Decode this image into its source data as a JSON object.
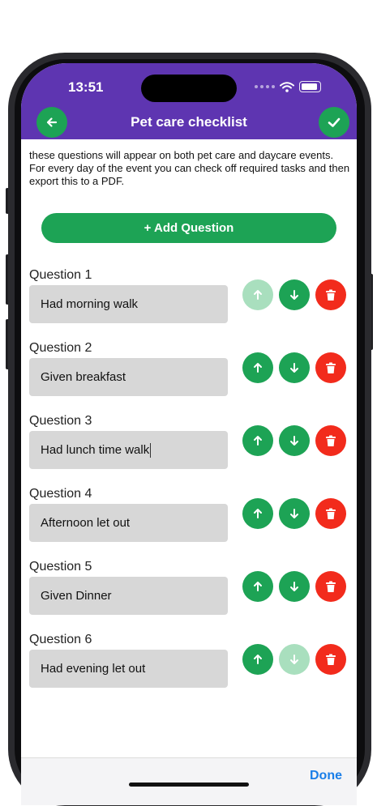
{
  "status_bar": {
    "time": "13:51"
  },
  "header": {
    "title": "Pet care checklist",
    "back_icon": "arrow-left-icon",
    "confirm_icon": "checkmark-icon",
    "color": "#5e35b1"
  },
  "intro_text": "these questions will appear on both pet care and daycare events. For every day of the event you can check off required tasks and then export this to a PDF.",
  "add_button": {
    "label": "+ Add Question"
  },
  "questions": [
    {
      "label": "Question 1",
      "value": "Had morning walk",
      "up_enabled": false,
      "down_enabled": true
    },
    {
      "label": "Question 2",
      "value": "Given breakfast",
      "up_enabled": true,
      "down_enabled": true
    },
    {
      "label": "Question 3",
      "value": "Had lunch time walk",
      "up_enabled": true,
      "down_enabled": true
    },
    {
      "label": "Question 4",
      "value": "Afternoon let out",
      "up_enabled": true,
      "down_enabled": true
    },
    {
      "label": "Question 5",
      "value": "Given Dinner",
      "up_enabled": true,
      "down_enabled": true
    },
    {
      "label": "Question 6",
      "value": "Had evening let out",
      "up_enabled": true,
      "down_enabled": false
    }
  ],
  "keyboard_toolbar": {
    "done_label": "Done"
  },
  "colors": {
    "accent_green": "#1da355",
    "disabled_green": "#a9dfbe",
    "delete_red": "#f22b1c",
    "done_blue": "#1a7ee8"
  }
}
